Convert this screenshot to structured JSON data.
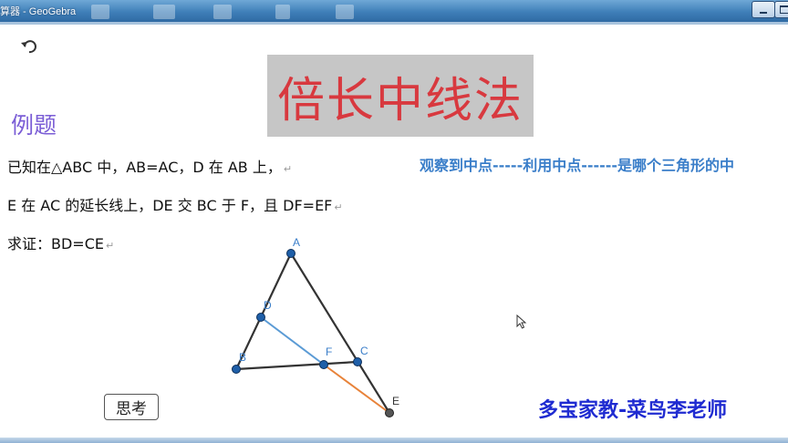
{
  "window": {
    "title": "算器 - GeoGebra"
  },
  "slide": {
    "heading": "倍长中线法",
    "example_label": "例题",
    "problem_lines": [
      "已知在△ABC 中，AB=AC，D 在 AB 上，",
      "E 在 AC 的延长线上，DE 交 BC 于 F，且 DF=EF",
      "求证：BD=CE"
    ],
    "line_mark": "↵",
    "hint": "观察到中点-----利用中点------是哪个三角形的中",
    "think_button": "思考",
    "credit": "多宝家教-菜鸟李老师"
  },
  "figure": {
    "points": {
      "A": "A",
      "B": "B",
      "C": "C",
      "D": "D",
      "E": "E",
      "F": "F"
    }
  },
  "icons": {
    "undo": "undo-icon",
    "cursor": "mouse-pointer-icon",
    "minimize": "minimize-icon",
    "maximize": "maximize-icon"
  },
  "colors": {
    "heading_text": "#d8393f",
    "heading_bg": "#c6c6c6",
    "example_label": "#7b5ed6",
    "hint": "#3a7ec9",
    "credit": "#1f2bd1",
    "point_fill": "#1f5fa8",
    "segment_de_blue": "#5b9bd5",
    "segment_fe_orange": "#e8833a",
    "triangle_stroke": "#333333"
  }
}
